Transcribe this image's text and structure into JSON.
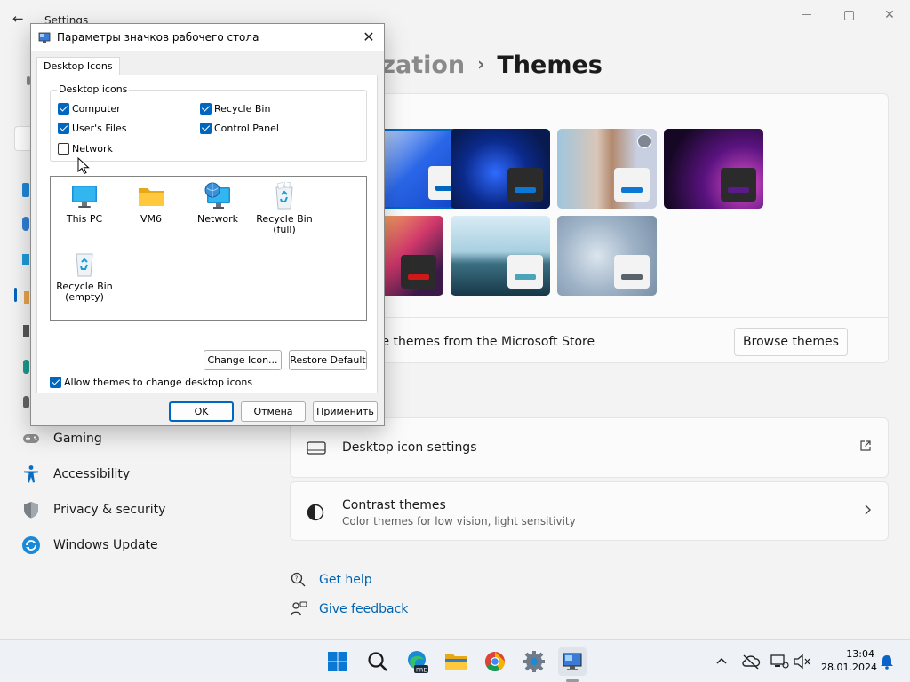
{
  "settings": {
    "app_title": "Settings",
    "breadcrumb": {
      "parent": "ization",
      "separator": "›",
      "current": "Themes"
    },
    "nav": [
      {
        "label": "Gaming",
        "icon": "gamepad-icon"
      },
      {
        "label": "Accessibility",
        "icon": "accessibility-icon"
      },
      {
        "label": "Privacy & security",
        "icon": "shield-icon"
      },
      {
        "label": "Windows Update",
        "icon": "windows-update-icon"
      }
    ],
    "themes": {
      "store_text": "re themes from the Microsoft Store",
      "browse_label": "Browse themes"
    },
    "desktop_icon_settings": {
      "title": "Desktop icon settings",
      "icon": "monitor-icon",
      "action_icon": "external-link-icon"
    },
    "contrast_themes": {
      "title": "Contrast themes",
      "subtitle": "Color themes for low vision, light sensitivity",
      "icon": "contrast-icon"
    },
    "links": {
      "help": "Get help",
      "feedback": "Give feedback"
    }
  },
  "dialog": {
    "title": "Параметры значков рабочего стола",
    "tab": "Desktop Icons",
    "group_label": "Desktop icons",
    "checkboxes": [
      {
        "label": "Computer",
        "checked": true
      },
      {
        "label": "Recycle Bin",
        "checked": true
      },
      {
        "label": "User's Files",
        "checked": true
      },
      {
        "label": "Control Panel",
        "checked": true
      },
      {
        "label": "Network",
        "checked": false
      }
    ],
    "icons": [
      {
        "label": "This PC",
        "icon": "monitor-icon"
      },
      {
        "label": "VM6",
        "icon": "folder-icon"
      },
      {
        "label": "Network",
        "icon": "network-icon"
      },
      {
        "label": "Recycle Bin (full)",
        "icon": "recycle-bin-full-icon"
      },
      {
        "label": "Recycle Bin (empty)",
        "icon": "recycle-bin-empty-icon"
      }
    ],
    "change_icon": "Change Icon...",
    "restore_default": "Restore Default",
    "allow_themes": {
      "label": "Allow themes to change desktop icons",
      "checked": true
    },
    "ok": "OK",
    "cancel": "Отмена",
    "apply": "Применить"
  },
  "taskbar": {
    "apps": [
      "start-icon",
      "search-icon",
      "edge-pre-icon",
      "file-explorer-icon",
      "chrome-icon",
      "settings-gear-icon",
      "desktop-icons-app-icon"
    ],
    "clock": {
      "time": "13:04",
      "date": "28.01.2024"
    }
  },
  "colors": {
    "accent": "#0067c0",
    "link": "#0063b1"
  }
}
